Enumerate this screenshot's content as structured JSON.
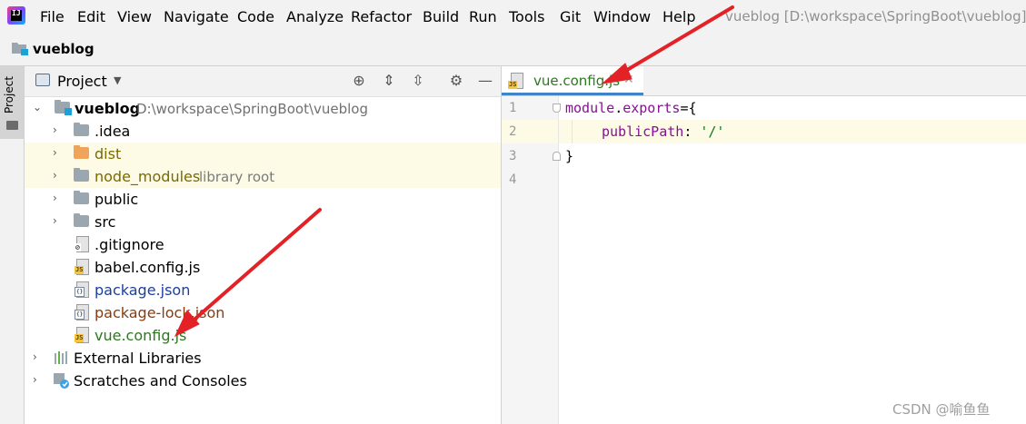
{
  "menubar": {
    "items": [
      "File",
      "Edit",
      "View",
      "Navigate",
      "Code",
      "Analyze",
      "Refactor",
      "Build",
      "Run",
      "Tools",
      "Git",
      "Window",
      "Help"
    ],
    "window_title": "vueblog [D:\\workspace\\SpringBoot\\vueblog]"
  },
  "navbar": {
    "project_name": "vueblog"
  },
  "left_strip": {
    "tab_label": "Project"
  },
  "project_panel": {
    "title": "Project",
    "root": {
      "name": "vueblog",
      "path": "D:\\workspace\\SpringBoot\\vueblog"
    },
    "items": [
      {
        "name": ".idea",
        "type": "folder",
        "color": "gray"
      },
      {
        "name": "dist",
        "type": "folder",
        "color": "orange"
      },
      {
        "name": "node_modules",
        "type": "folder",
        "color": "gray",
        "suffix": "library root"
      },
      {
        "name": "public",
        "type": "folder",
        "color": "gray"
      },
      {
        "name": "src",
        "type": "folder",
        "color": "gray"
      },
      {
        "name": ".gitignore",
        "type": "file",
        "icon": "gitignore-file-icon"
      },
      {
        "name": "babel.config.js",
        "type": "file",
        "icon": "js-file-icon"
      },
      {
        "name": "package.json",
        "type": "file",
        "icon": "json-file-icon"
      },
      {
        "name": "package-lock.json",
        "type": "file",
        "icon": "json-file-icon"
      },
      {
        "name": "vue.config.js",
        "type": "file",
        "icon": "js-file-icon"
      }
    ],
    "external_libraries": "External Libraries",
    "scratches": "Scratches and Consoles"
  },
  "editor": {
    "tab_label": "vue.config.js",
    "line_numbers": [
      "1",
      "2",
      "3",
      "4"
    ],
    "code": {
      "line1_a": "module",
      "line1_b": ".",
      "line1_c": "exports",
      "line1_d": "={",
      "line2_a": "publicPath",
      "line2_b": ": ",
      "line2_c": "'/'",
      "line3": "}"
    }
  },
  "watermark": "CSDN @喻鱼鱼",
  "colors": {
    "menubar_bg": "#f2f2f2",
    "selection_bg": "#fdfbe6",
    "tab_underline": "#4083c9",
    "annotation_arrow": "#e32228"
  }
}
